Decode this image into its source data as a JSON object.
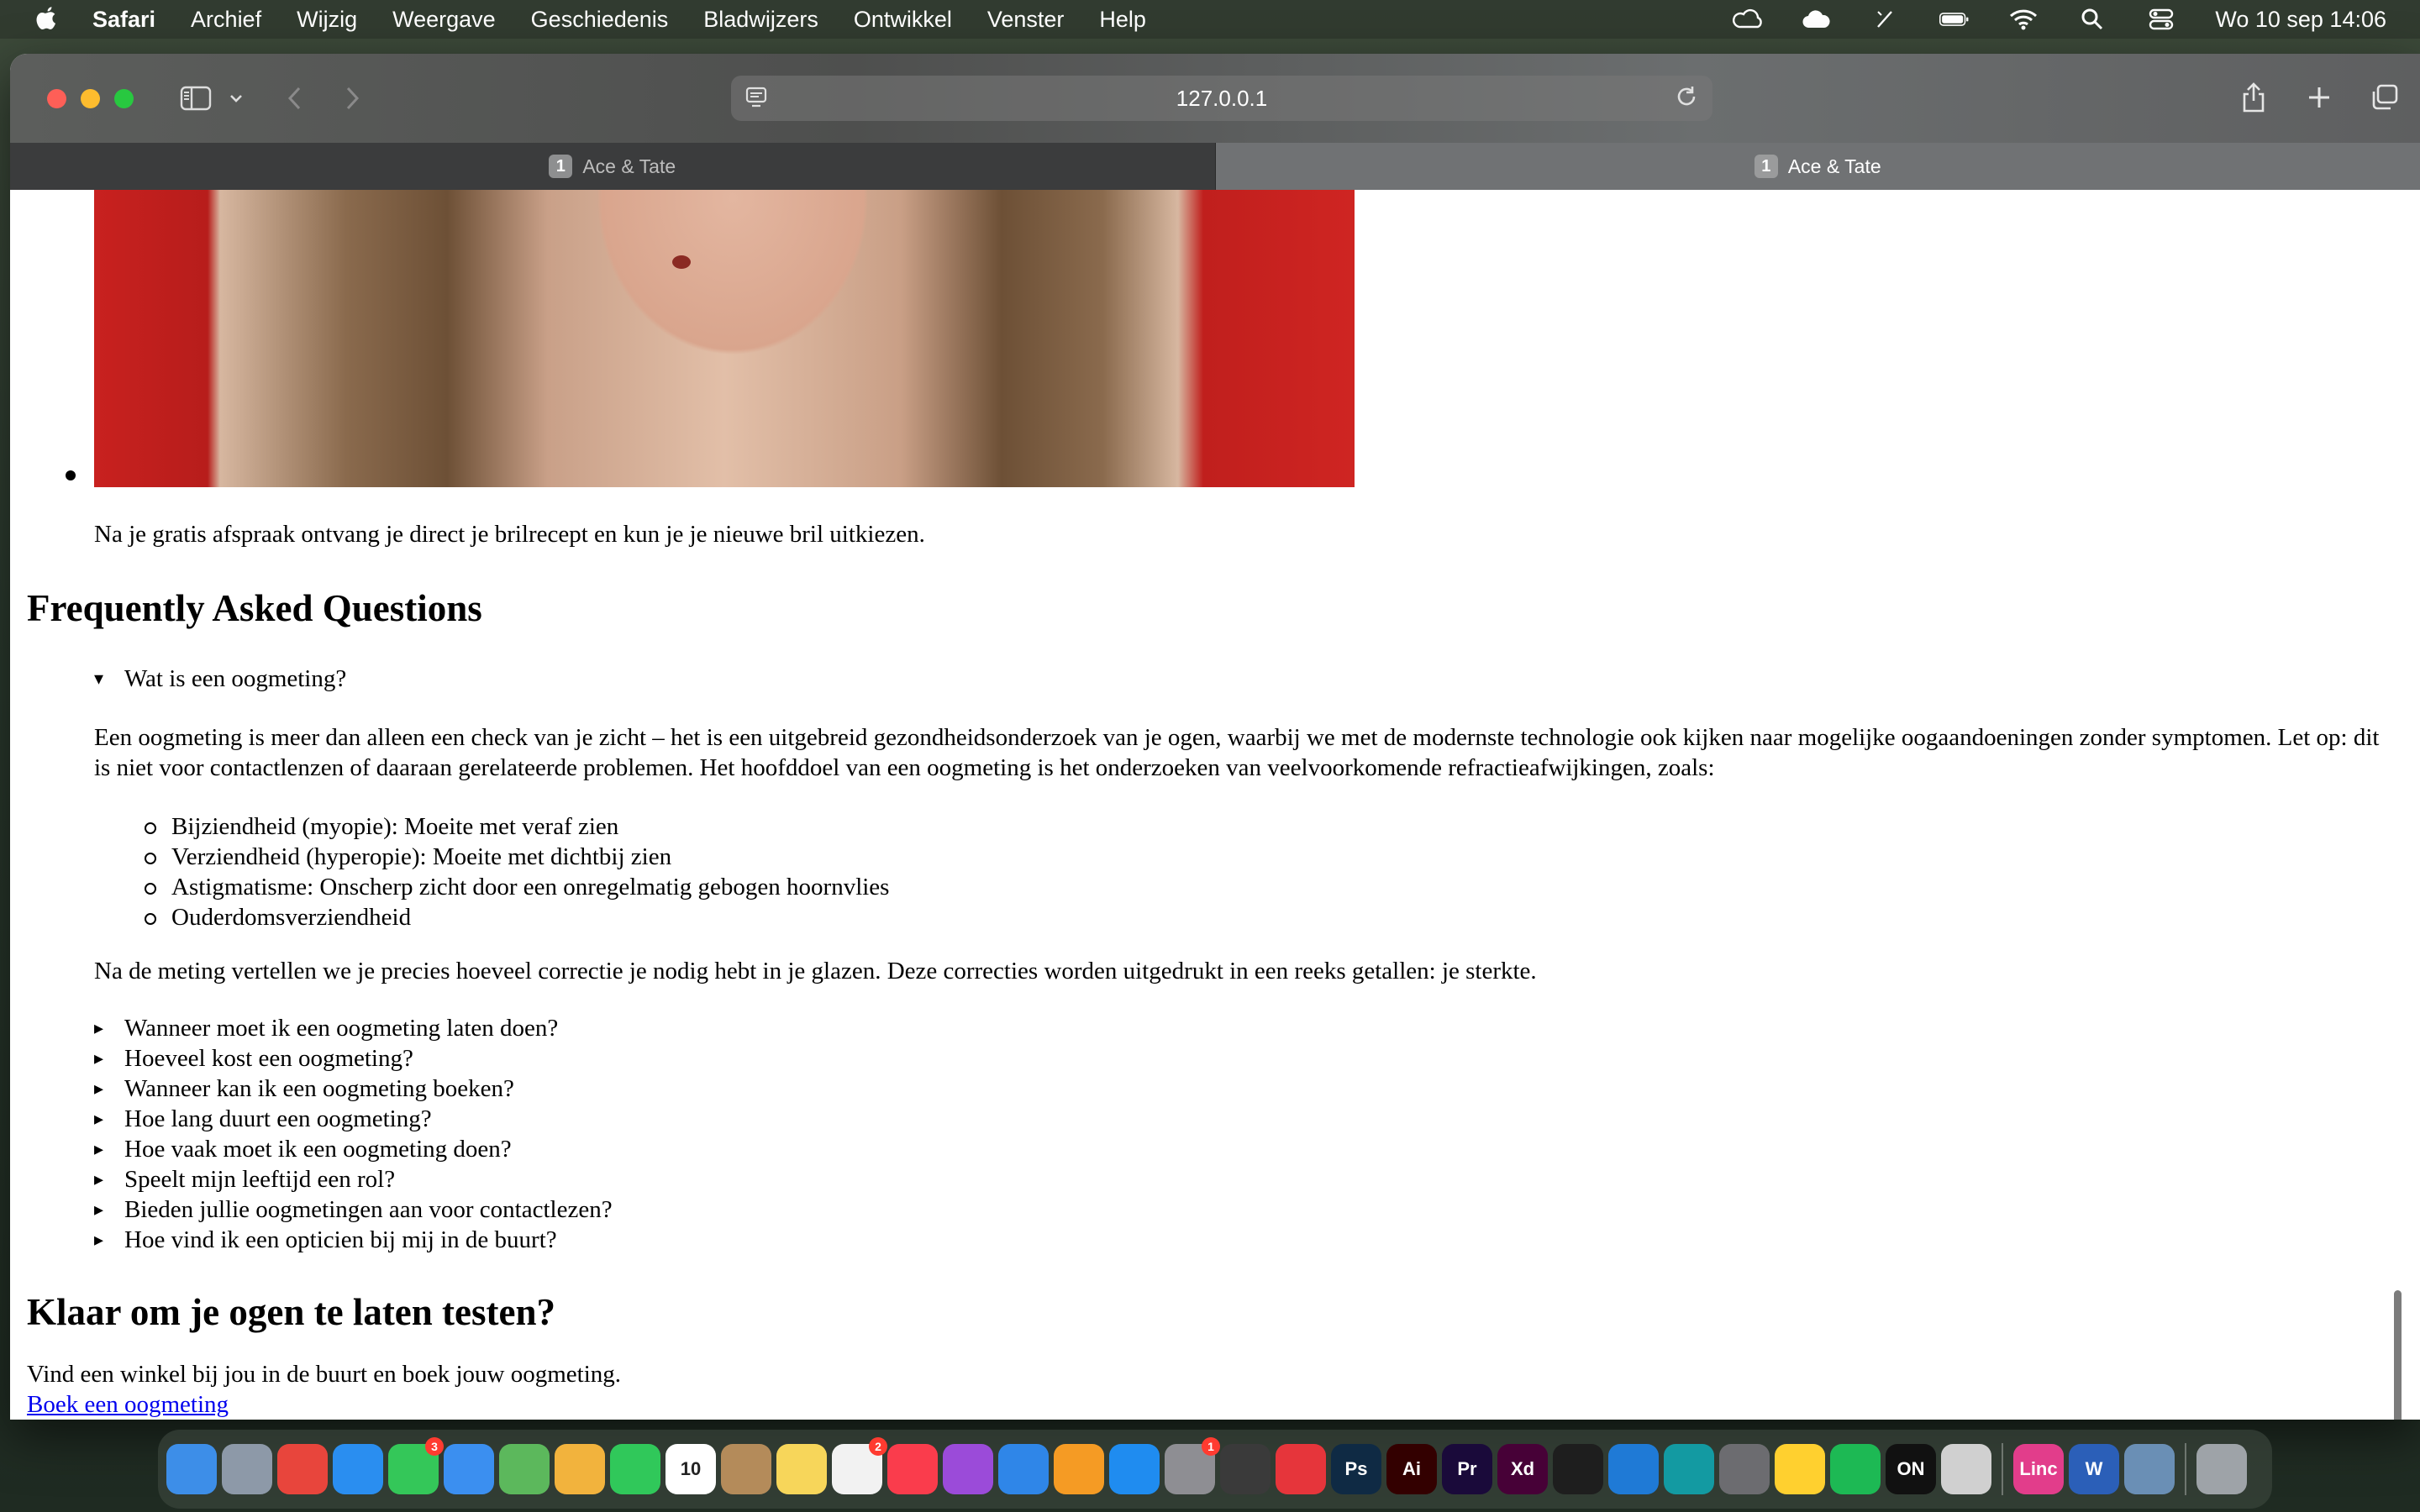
{
  "menubar": {
    "app_name": "Safari",
    "items": [
      "Archief",
      "Wijzig",
      "Weergave",
      "Geschiedenis",
      "Bladwijzers",
      "Ontwikkel",
      "Venster",
      "Help"
    ],
    "clock": "Wo 10 sep  14:06"
  },
  "browser": {
    "url": "127.0.0.1",
    "tabs": [
      {
        "badge": "1",
        "title": "Ace & Tate",
        "active": false
      },
      {
        "badge": "1",
        "title": "Ace & Tate",
        "active": true
      }
    ]
  },
  "content": {
    "after_image_text": "Na je gratis afspraak ontvang je direct je brilrecept en kun je je nieuwe bril uitkiezen.",
    "faq_heading": "Frequently Asked Questions",
    "faq_open": {
      "marker": "▾",
      "question": "Wat is een oogmeting?",
      "answer_intro": "Een oogmeting is meer dan alleen een check van je zicht – het is een uitgebreid gezondheidsonderzoek van je ogen, waarbij we met de modernste technologie ook kijken naar mogelijke oogaandoeningen zonder symptomen. Let op: dit is niet voor contactlenzen of daaraan gerelateerde problemen. Het hoofddoel van een oogmeting is het onderzoeken van veelvoorkomende refractieafwijkingen, zoals:",
      "conditions": [
        "Bijziendheid (myopie): Moeite met veraf zien",
        "Verziendheid (hyperopie): Moeite met dichtbij zien",
        "Astigmatisme: Onscherp zicht door een onregelmatig gebogen hoornvlies",
        "Ouderdomsverziendheid"
      ],
      "answer_outro": "Na de meting vertellen we je precies hoeveel correctie je nodig hebt in je glazen. Deze correcties worden uitgedrukt in een reeks getallen: je sterkte."
    },
    "faq_closed_marker": "▸",
    "faq_closed": [
      "Wanneer moet ik een oogmeting laten doen?",
      "Hoeveel kost een oogmeting?",
      "Wanneer kan ik een oogmeting boeken?",
      "Hoe lang duurt een oogmeting?",
      "Hoe vaak moet ik een oogmeting doen?",
      "Speelt mijn leeftijd een rol?",
      "Bieden jullie oogmetingen aan voor contactlezen?",
      "Hoe vind ik een opticien bij mij in de buurt?"
    ],
    "cta_heading": "Klaar om je ogen te laten testen?",
    "cta_text": "Vind een winkel bij jou in de buurt en boek jouw oogmeting.",
    "cta_link": "Boek een oogmeting"
  },
  "dock": {
    "apps": [
      {
        "icon": "finder-icon",
        "color": "#3d8ee8",
        "label": ""
      },
      {
        "icon": "launchpad-icon",
        "color": "#8d99a8",
        "label": ""
      },
      {
        "icon": "chrome-icon",
        "color": "#e8453c",
        "label": ""
      },
      {
        "icon": "safari-icon",
        "color": "#2a8ef0",
        "label": ""
      },
      {
        "icon": "messages-icon",
        "color": "#34c759",
        "label": "",
        "badge": "3"
      },
      {
        "icon": "mail-icon",
        "color": "#3b8ff0",
        "label": ""
      },
      {
        "icon": "maps-icon",
        "color": "#5cb85c",
        "label": ""
      },
      {
        "icon": "photos-icon",
        "color": "#f2b33d",
        "label": ""
      },
      {
        "icon": "facetime-icon",
        "color": "#30c85a",
        "label": ""
      },
      {
        "icon": "calendar-icon",
        "color": "#ffffff",
        "label": "10"
      },
      {
        "icon": "contacts-icon",
        "color": "#b48b5a",
        "label": ""
      },
      {
        "icon": "notes-icon",
        "color": "#f7d65a",
        "label": ""
      },
      {
        "icon": "reminders-icon",
        "color": "#f2f2f2",
        "label": "",
        "badge": "2"
      },
      {
        "icon": "music-icon",
        "color": "#fa3c4c",
        "label": ""
      },
      {
        "icon": "podcasts-icon",
        "color": "#9b4bd9",
        "label": ""
      },
      {
        "icon": "keynote-icon",
        "color": "#2f86e8",
        "label": ""
      },
      {
        "icon": "pages-icon",
        "color": "#f59b24",
        "label": ""
      },
      {
        "icon": "app-store-icon",
        "color": "#1f8cf0",
        "label": ""
      },
      {
        "icon": "system-settings-icon",
        "color": "#8e8e93",
        "label": "",
        "badge": "1"
      },
      {
        "icon": "garageband-icon",
        "color": "#3a3a3a",
        "label": ""
      },
      {
        "icon": "creative-cloud-icon",
        "color": "#e6353b",
        "label": ""
      },
      {
        "icon": "photoshop-icon",
        "color": "#0f2a44",
        "label": "Ps"
      },
      {
        "icon": "illustrator-icon",
        "color": "#330000",
        "label": "Ai"
      },
      {
        "icon": "premiere-icon",
        "color": "#1a0a3a",
        "label": "Pr"
      },
      {
        "icon": "xd-icon",
        "color": "#470137",
        "label": "Xd"
      },
      {
        "icon": "figma-icon",
        "color": "#1e1e1e",
        "label": ""
      },
      {
        "icon": "vscode-icon",
        "color": "#1f7ad6",
        "label": ""
      },
      {
        "icon": "arduino-icon",
        "color": "#139aa2",
        "label": ""
      },
      {
        "icon": "unity-icon",
        "color": "#6c6c70",
        "label": ""
      },
      {
        "icon": "miro-icon",
        "color": "#ffd02f",
        "label": ""
      },
      {
        "icon": "spotify-icon",
        "color": "#1db954",
        "label": ""
      },
      {
        "icon": "on-icon",
        "color": "#111111",
        "label": "ON"
      },
      {
        "icon": "notion-icon",
        "color": "#d0d0d0",
        "label": ""
      },
      {
        "icon": "linc-icon",
        "color": "#e23d8b",
        "label": "Linc"
      },
      {
        "icon": "word-icon",
        "color": "#2b5fb8",
        "label": "W"
      },
      {
        "icon": "preview-icon",
        "color": "#6a8fb5",
        "label": ""
      },
      {
        "icon": "trash-icon",
        "color": "#9ea3a8",
        "label": ""
      }
    ]
  }
}
